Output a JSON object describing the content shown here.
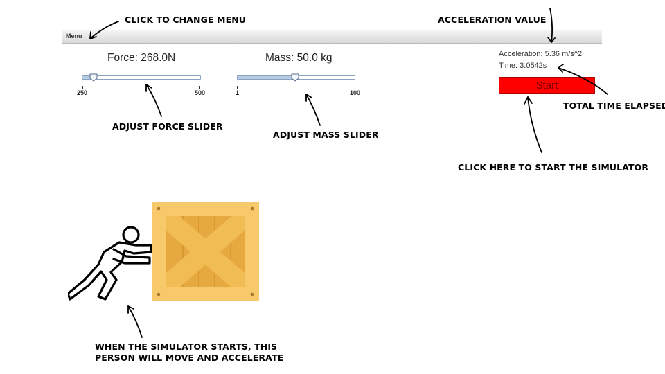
{
  "menu": {
    "label": "Menu"
  },
  "sliders": {
    "force": {
      "label": "Force: 268.0N",
      "min_label": "250",
      "max_label": "500",
      "value": 268.0,
      "min": 250,
      "max": 500
    },
    "mass": {
      "label": "Mass: 50.0 kg",
      "min_label": "1",
      "max_label": "100",
      "value": 50.0,
      "min": 1,
      "max": 100
    }
  },
  "readouts": {
    "acceleration": "Acceleration: 5.36 m/s^2",
    "time": "Time: 3.0542s"
  },
  "start_button": {
    "label": "Start",
    "color": "#ff0000"
  },
  "annotations": {
    "change_menu": "CLICK TO CHANGE MENU",
    "acceleration_value": "ACCELERATION VALUE",
    "total_time": "TOTAL TIME ELAPSED",
    "adjust_force": "ADJUST FORCE SLIDER",
    "adjust_mass": "ADJUST MASS SLIDER",
    "start_sim": "CLICK HERE TO START THE SIMULATOR",
    "person_line1": "WHEN THE SIMULATOR STARTS, THIS",
    "person_line2": "PERSON WILL MOVE AND ACCELERATE"
  },
  "colors": {
    "crate_light": "#f7c96a",
    "crate_mid": "#eab046",
    "crate_dark": "#dfa036",
    "button_red": "#ff0000"
  },
  "icons": {
    "person": "person-pushing-icon",
    "crate": "wooden-crate-icon"
  }
}
